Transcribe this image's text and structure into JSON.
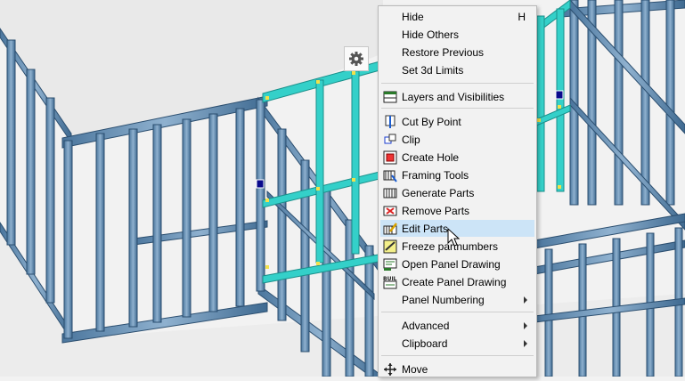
{
  "menu": {
    "items": [
      {
        "label": "Hide",
        "shortcut": "H",
        "icon": "none"
      },
      {
        "label": "Hide Others",
        "icon": "none"
      },
      {
        "label": "Restore Previous",
        "icon": "none"
      },
      {
        "label": "Set 3d Limits",
        "icon": "none"
      },
      {
        "label": "Layers and Visibilities",
        "icon": "layers-icon"
      },
      {
        "label": "Cut By Point",
        "icon": "cut-by-point-icon"
      },
      {
        "label": "Clip",
        "icon": "clip-icon"
      },
      {
        "label": "Create Hole",
        "icon": "create-hole-icon"
      },
      {
        "label": "Framing Tools",
        "icon": "framing-tools-icon"
      },
      {
        "label": "Generate Parts",
        "icon": "generate-parts-icon"
      },
      {
        "label": "Remove Parts",
        "icon": "remove-parts-icon"
      },
      {
        "label": "Edit Parts",
        "icon": "edit-parts-icon",
        "highlighted": true
      },
      {
        "label": "Freeze partnumbers",
        "icon": "freeze-partnumbers-icon"
      },
      {
        "label": "Open Panel Drawing",
        "icon": "open-panel-drawing-icon"
      },
      {
        "label": "Create Panel Drawing",
        "icon": "create-panel-drawing-icon",
        "icon_text": "BUILD"
      },
      {
        "label": "Panel Numbering",
        "icon": "none",
        "submenu": true
      },
      {
        "label": "Advanced",
        "icon": "none",
        "submenu": true
      },
      {
        "label": "Clipboard",
        "icon": "none",
        "submenu": true
      },
      {
        "label": "Move",
        "icon": "move-icon"
      }
    ]
  },
  "colors": {
    "menu_bg": "#f2f2f2",
    "highlight": "#cce4f7",
    "stud": "#6c93b8",
    "stud_dark": "#3f6a91",
    "selected_member": "#2ec8c2",
    "grip": "#0a0a8c",
    "ground": "#f2f2f2"
  }
}
